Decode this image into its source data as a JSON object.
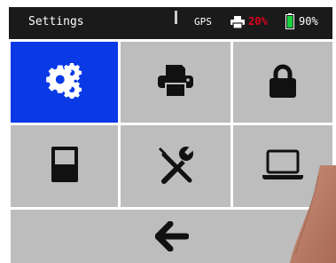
{
  "status_bar": {
    "title": "Settings",
    "gps_label": "GPS",
    "printer_level": "20%",
    "printer_color": "#e0001b",
    "battery_level": "90%",
    "battery_color": "#19d23c"
  },
  "tiles": [
    {
      "name": "settings-tile",
      "icon": "gears-icon",
      "selected": true
    },
    {
      "name": "printer-tile",
      "icon": "printer-icon",
      "selected": false
    },
    {
      "name": "lock-tile",
      "icon": "lock-icon",
      "selected": false
    },
    {
      "name": "device-tile",
      "icon": "device-icon",
      "selected": false
    },
    {
      "name": "tools-tile",
      "icon": "tools-icon",
      "selected": false
    },
    {
      "name": "laptop-tile",
      "icon": "laptop-icon",
      "selected": false
    },
    {
      "name": "back-tile",
      "icon": "arrow-left-icon",
      "selected": false
    }
  ],
  "colors": {
    "selected_tile": "#0a3ae6",
    "tile": "#bdbdbd",
    "icon": "#111111",
    "status_bar": "#1a1a1a"
  }
}
